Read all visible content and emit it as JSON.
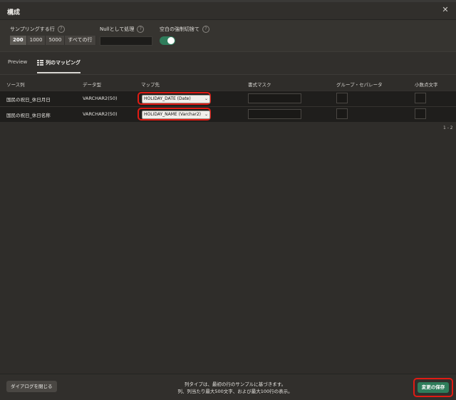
{
  "dialog": {
    "title": "構成",
    "close_glyph": "✕"
  },
  "settings": {
    "sample_rows_label": "サンプリングする行",
    "sample_options": [
      "200",
      "1000",
      "5000",
      "すべての行"
    ],
    "selected_sample": "200",
    "null_label": "Nullとして処理",
    "null_value": "",
    "trim_label": "空白の強制切捨て",
    "trim_enabled": true,
    "help_glyph": "?"
  },
  "tabs": {
    "preview": "Preview",
    "mapping": "列のマッピング"
  },
  "grid": {
    "headers": {
      "source": "ソース列",
      "datatype": "データ型",
      "target": "マップ先",
      "format": "書式マスク",
      "group_sep": "グループ・セパレータ",
      "decimal": "小数点文字"
    },
    "rows": [
      {
        "source": "国民の祝日_休日月日",
        "datatype": "VARCHAR2(50)",
        "target": "HOLIDAY_DATE (Date)",
        "format": ""
      },
      {
        "source": "国民の祝日_休日名称",
        "datatype": "VARCHAR2(50)",
        "target": "HOLIDAY_NAME (Varchar2)",
        "format": ""
      }
    ],
    "pager": "1 - 2"
  },
  "footer": {
    "close_button": "ダイアログを閉じる",
    "note_line1": "列タイプは、最初の行のサンプルに基づきます。",
    "note_line2": "列、列当たり最大500文字、および最大100行の表示。",
    "save_button": "変更の保存"
  },
  "colors": {
    "accent_green": "#2f7d5b",
    "highlight_red": "#e01b14"
  }
}
